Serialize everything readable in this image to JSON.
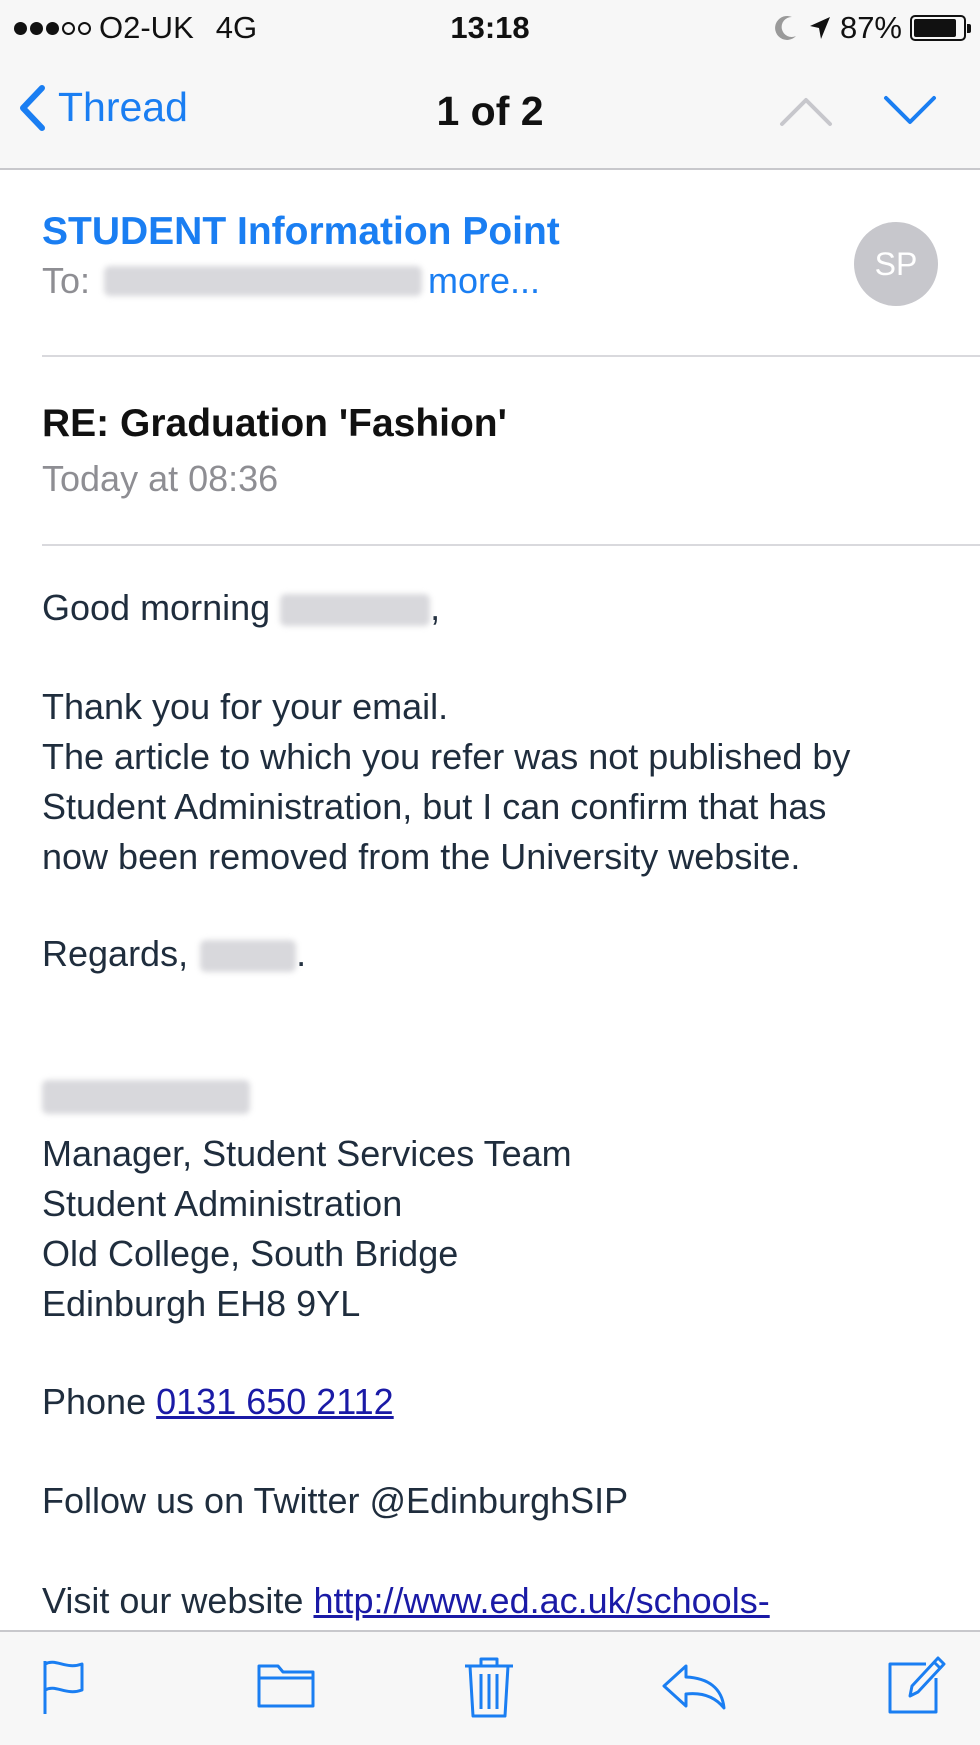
{
  "status_bar": {
    "carrier": "O2-UK",
    "network": "4G",
    "time": "13:18",
    "battery": "87%",
    "battery_level": 0.87,
    "icons": [
      "signal-dots-icon",
      "moon-icon",
      "location-arrow-icon",
      "battery-icon"
    ]
  },
  "nav": {
    "back_label": "Thread",
    "title": "1 of 2",
    "icons": [
      "chevron-left-icon",
      "chevron-up-icon",
      "chevron-down-icon"
    ]
  },
  "message": {
    "sender": "STUDENT Information Point",
    "to_label": "To:",
    "more_label": "more...",
    "avatar_initials": "SP",
    "subject": "RE: Graduation 'Fashion'",
    "date": "Today at 08:36",
    "greeting": "Good morning",
    "greeting_end": ",",
    "para_lines": [
      "Thank you for your email.",
      "The article to which you refer was not published by",
      "Student Administration, but I can confirm that has",
      "now been removed from the University website."
    ],
    "regards": "Regards,",
    "regards_end": ".",
    "signature_lines": [
      "Manager, Student Services Team",
      "Student Administration",
      "Old College, South Bridge",
      "Edinburgh EH8 9YL"
    ],
    "phone_label": "Phone",
    "phone_number": "0131 650 2112",
    "twitter_line": "Follow us on Twitter @EdinburghSIP",
    "website_label": "Visit our website",
    "website_url": "http://www.ed.ac.uk/schools-"
  },
  "toolbar": {
    "icons": [
      "flag-icon",
      "folder-icon",
      "trash-icon",
      "reply-icon",
      "compose-icon"
    ]
  },
  "colors": {
    "accent": "#1a7ef2",
    "link": "#1a1aa6",
    "body_text": "#1f2d3d",
    "secondary_text": "#8e8e93"
  }
}
